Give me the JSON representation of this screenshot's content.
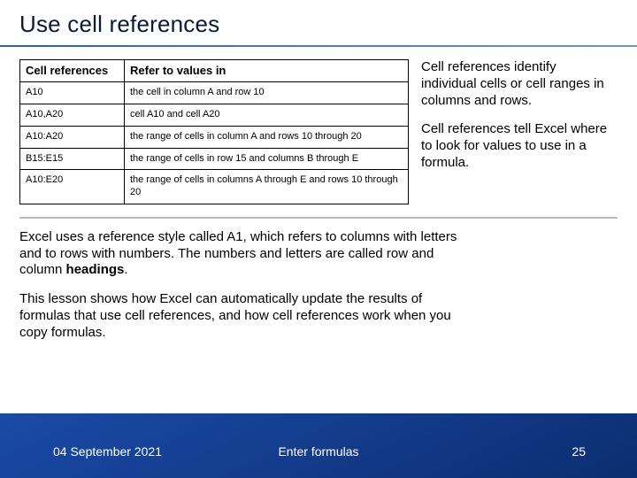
{
  "title": "Use cell references",
  "table": {
    "headers": [
      "Cell references",
      "Refer to values in"
    ],
    "rows": [
      [
        "A10",
        "the cell in column A and row 10"
      ],
      [
        "A10,A20",
        "cell A10 and cell A20"
      ],
      [
        "A10:A20",
        "the range of cells in column A and rows 10 through 20"
      ],
      [
        "B15:E15",
        "the range of cells in row 15 and columns B through E"
      ],
      [
        "A10:E20",
        "the range of cells in columns A through E and rows 10 through 20"
      ]
    ]
  },
  "side": {
    "p1": "Cell references identify individual cells or cell ranges in columns and rows.",
    "p2": "Cell references tell Excel where to look for values to use in a formula."
  },
  "body": {
    "p1a": "Excel uses a reference style called A1, which refers to columns with letters and to rows with numbers. The numbers and letters are called row and column ",
    "p1b": "headings",
    "p1c": ".",
    "p2": "This lesson shows how Excel can automatically update the results of formulas that use cell references, and how cell references work when you copy formulas."
  },
  "footer": {
    "date": "04 September 2021",
    "center": "Enter formulas",
    "page": "25"
  }
}
